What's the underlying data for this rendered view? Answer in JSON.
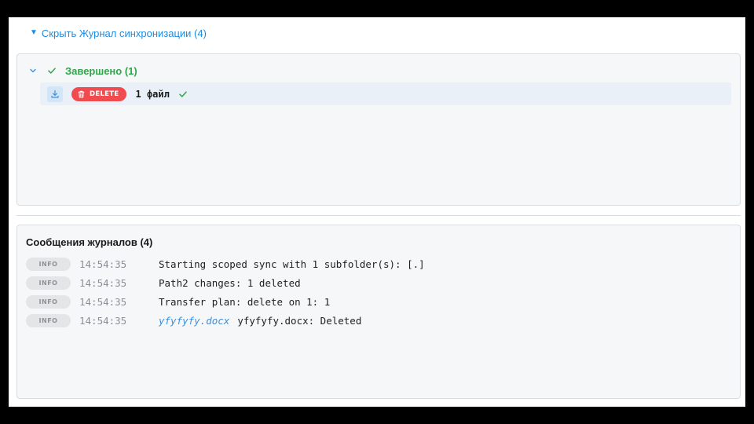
{
  "toggle": {
    "arrow": "▼",
    "label": "Скрыть Журнал синхронизации (4)"
  },
  "sync": {
    "group": {
      "label": "Завершено (1)",
      "expanded": true,
      "color": "#2fa64a"
    },
    "file_row": {
      "badge_label": "DELETE",
      "badge_color": "#f04b4e",
      "count_label": "1 файл",
      "download_icon": "download-icon",
      "trash_icon": "trash-icon",
      "status_icon": "check-icon"
    }
  },
  "logs": {
    "title": "Сообщения журналов (4)",
    "entries": [
      {
        "level": "INFO",
        "time": "14:54:35",
        "message": "Starting scoped sync with 1 subfolder(s): [.]"
      },
      {
        "level": "INFO",
        "time": "14:54:35",
        "message": "Path2 changes: 1 deleted"
      },
      {
        "level": "INFO",
        "time": "14:54:35",
        "message": "Transfer plan: delete on 1: 1"
      },
      {
        "level": "INFO",
        "time": "14:54:35",
        "file_link": "yfyfyfy.docx",
        "message": "yfyfyfy.docx: Deleted"
      }
    ]
  },
  "colors": {
    "accent": "#1d8de0",
    "success": "#2fa64a",
    "danger": "#f04b4e"
  }
}
